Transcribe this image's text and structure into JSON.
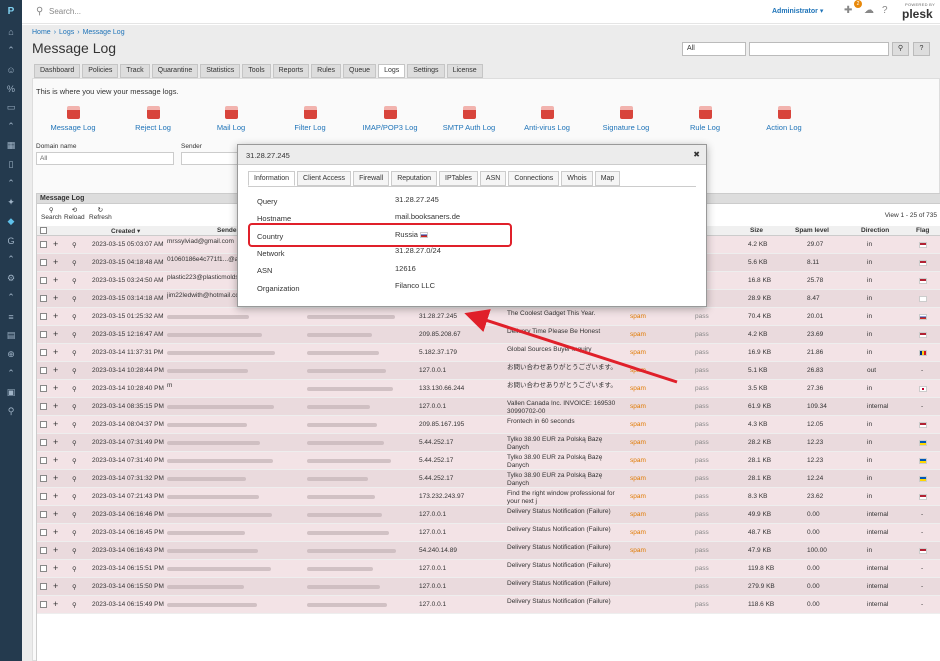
{
  "topbar": {
    "search_placeholder": "Search...",
    "user": "Administrator ▾",
    "notif_count": "2",
    "powered_by": "POWERED BY",
    "brand": "plesk"
  },
  "breadcrumb": [
    "Home",
    "›",
    "Logs",
    "›",
    "Message Log"
  ],
  "page_title": "Message Log",
  "filter_select": "All",
  "tabs": [
    "Dashboard",
    "Policies",
    "Track",
    "Quarantine",
    "Statistics",
    "Tools",
    "Reports",
    "Rules",
    "Queue",
    "Logs",
    "Settings",
    "License"
  ],
  "active_tab": "Logs",
  "intro": "This is where you view your message logs.",
  "log_links": [
    "Message Log",
    "Reject Log",
    "Mail Log",
    "Filter Log",
    "IMAP/POP3 Log",
    "SMTP Auth Log",
    "Anti-virus Log",
    "Signature Log",
    "Rule Log",
    "Action Log"
  ],
  "filters": {
    "domain_label": "Domain name",
    "domain_value": "All",
    "sender_label": "Sender"
  },
  "grid": {
    "title": "Message Log",
    "tools": [
      "Search",
      "Reload",
      "Refresh"
    ],
    "view": "View 1 - 25 of 735",
    "columns": {
      "created": "Created ▾",
      "sender": "Sender",
      "category": "ry",
      "size": "Size",
      "spam": "Spam level",
      "direction": "Direction",
      "flag": "Flag"
    },
    "rows": [
      {
        "created": "2023-03-15 05:03:07 AM",
        "sender": "mrssylviad@gmail.com",
        "ip": "",
        "subject": "",
        "cat": "",
        "pass": "",
        "size": "4.2 KB",
        "spam": "29.07",
        "dir": "in",
        "flag": "us"
      },
      {
        "created": "2023-03-15 04:18:48 AM",
        "sender": "01060186e4c771f1...@ap-...1.amazonses.com",
        "ip": "",
        "subject": "",
        "cat": "",
        "pass": "",
        "size": "5.6 KB",
        "spam": "8.11",
        "dir": "in",
        "flag": "us"
      },
      {
        "created": "2023-03-15 03:24:50 AM",
        "sender": "plastic223@plasticmoldsb...",
        "ip": "",
        "subject": "",
        "cat": "",
        "pass": "",
        "size": "16.8 KB",
        "spam": "25.78",
        "dir": "in",
        "flag": "us"
      },
      {
        "created": "2023-03-15 03:14:18 AM",
        "sender": "jim22ledwith@hotmail.co...",
        "ip": "",
        "subject": "",
        "cat": "",
        "pass": "",
        "size": "28.9 KB",
        "spam": "8.47",
        "dir": "in",
        "flag": "kr"
      },
      {
        "created": "2023-03-15 01:25:32 AM",
        "sender": "",
        "ip": "31.28.27.245",
        "subject": "The Coolest Gadget This Year.",
        "cat": "spam",
        "pass": "pass",
        "size": "70.4 KB",
        "spam": "20.01",
        "dir": "in",
        "flag": "ru"
      },
      {
        "created": "2023-03-15 12:16:47 AM",
        "sender": "",
        "ip": "209.85.208.67",
        "subject": "Delivery Time Please Be Honest",
        "cat": "spam",
        "pass": "pass",
        "size": "4.2 KB",
        "spam": "23.69",
        "dir": "in",
        "flag": "us"
      },
      {
        "created": "2023-03-14 11:37:31 PM",
        "sender": "",
        "ip": "5.182.37.179",
        "subject": "Global Sources Buyer Inquiry",
        "cat": "spam",
        "pass": "pass",
        "size": "16.9 KB",
        "spam": "21.86",
        "dir": "in",
        "flag": "ro"
      },
      {
        "created": "2023-03-14 10:28:44 PM",
        "sender": "",
        "ip": "127.0.0.1",
        "subject": "お問い合わせありがとうございます。",
        "cat": "spam",
        "pass": "pass",
        "size": "5.1 KB",
        "spam": "26.83",
        "dir": "out",
        "flag": "-"
      },
      {
        "created": "2023-03-14 10:28:40 PM",
        "sender": "m",
        "ip": "133.130.66.244",
        "subject": "お問い合わせありがとうございます。",
        "cat": "spam",
        "pass": "pass",
        "size": "3.5 KB",
        "spam": "27.36",
        "dir": "in",
        "flag": "jp"
      },
      {
        "created": "2023-03-14 08:35:15 PM",
        "sender": "",
        "ip": "127.0.0.1",
        "subject": "Vallen Canada Inc. INVOICE: 169530 30990702-00",
        "cat": "spam",
        "pass": "pass",
        "size": "61.9 KB",
        "spam": "109.34",
        "dir": "internal",
        "flag": "-"
      },
      {
        "created": "2023-03-14 08:04:37 PM",
        "sender": "",
        "ip": "209.85.167.195",
        "subject": "Frontech in 60 seconds",
        "cat": "spam",
        "pass": "pass",
        "size": "4.3 KB",
        "spam": "12.05",
        "dir": "in",
        "flag": "us"
      },
      {
        "created": "2023-03-14 07:31:49 PM",
        "sender": "",
        "ip": "5.44.252.17",
        "subject": "Tylko 38.90 EUR za Polską Bazę Danych",
        "cat": "spam",
        "pass": "pass",
        "size": "28.2 KB",
        "spam": "12.23",
        "dir": "in",
        "flag": "ua"
      },
      {
        "created": "2023-03-14 07:31:40 PM",
        "sender": "",
        "ip": "5.44.252.17",
        "subject": "Tylko 38.90 EUR za Polską Bazę Danych",
        "cat": "spam",
        "pass": "pass",
        "size": "28.1 KB",
        "spam": "12.23",
        "dir": "in",
        "flag": "ua"
      },
      {
        "created": "2023-03-14 07:31:32 PM",
        "sender": "",
        "ip": "5.44.252.17",
        "subject": "Tylko 38.90 EUR za Polską Bazę Danych",
        "cat": "spam",
        "pass": "pass",
        "size": "28.1 KB",
        "spam": "12.24",
        "dir": "in",
        "flag": "ua"
      },
      {
        "created": "2023-03-14 07:21:43 PM",
        "sender": "",
        "ip": "173.232.243.97",
        "subject": "Find the right window professional for your next j",
        "cat": "spam",
        "pass": "pass",
        "size": "8.3 KB",
        "spam": "23.62",
        "dir": "in",
        "flag": "us"
      },
      {
        "created": "2023-03-14 06:16:46 PM",
        "sender": "",
        "ip": "127.0.0.1",
        "subject": "Delivery Status Notification (Failure)",
        "cat": "spam",
        "pass": "pass",
        "size": "49.9 KB",
        "spam": "0.00",
        "dir": "internal",
        "flag": "-"
      },
      {
        "created": "2023-03-14 06:16:45 PM",
        "sender": "",
        "ip": "127.0.0.1",
        "subject": "Delivery Status Notification (Failure)",
        "cat": "spam",
        "pass": "pass",
        "size": "48.7 KB",
        "spam": "0.00",
        "dir": "internal",
        "flag": "-"
      },
      {
        "created": "2023-03-14 06:16:43 PM",
        "sender": "",
        "ip": "54.240.14.89",
        "subject": "Delivery Status Notification (Failure)",
        "cat": "spam",
        "pass": "pass",
        "size": "47.9 KB",
        "spam": "100.00",
        "dir": "in",
        "flag": "us"
      },
      {
        "created": "2023-03-14 06:15:51 PM",
        "sender": "",
        "ip": "127.0.0.1",
        "subject": "Delivery Status Notification (Failure)",
        "cat": "",
        "pass": "pass",
        "size": "119.8 KB",
        "spam": "0.00",
        "dir": "internal",
        "flag": "-"
      },
      {
        "created": "2023-03-14 06:15:50 PM",
        "sender": "",
        "ip": "127.0.0.1",
        "subject": "Delivery Status Notification (Failure)",
        "cat": "",
        "pass": "pass",
        "size": "279.9 KB",
        "spam": "0.00",
        "dir": "internal",
        "flag": "-"
      },
      {
        "created": "2023-03-14 06:15:49 PM",
        "sender": "",
        "ip": "127.0.0.1",
        "subject": "Delivery Status Notification (Failure)",
        "cat": "",
        "pass": "pass",
        "size": "118.6 KB",
        "spam": "0.00",
        "dir": "internal",
        "flag": "-"
      }
    ]
  },
  "dialog": {
    "title": "31.28.27.245",
    "close": "✖",
    "tabs": [
      "Information",
      "Client Access",
      "Firewall",
      "Reputation",
      "IPTables",
      "ASN",
      "Connections",
      "Whois",
      "Map"
    ],
    "fields": [
      {
        "label": "Query",
        "value": "31.28.27.245"
      },
      {
        "label": "Hostname",
        "value": "mail.booksaners.de"
      },
      {
        "label": "Country",
        "value": "Russia"
      },
      {
        "label": "Network",
        "value": "31.28.27.0/24"
      },
      {
        "label": "ASN",
        "value": "12616"
      },
      {
        "label": "Organization",
        "value": "Filanco LLC"
      }
    ]
  },
  "colors": {
    "rail": "#243a4e",
    "link": "#1e73b8",
    "highlight": "#e0202a",
    "row_pink": "#f3e3e6"
  }
}
